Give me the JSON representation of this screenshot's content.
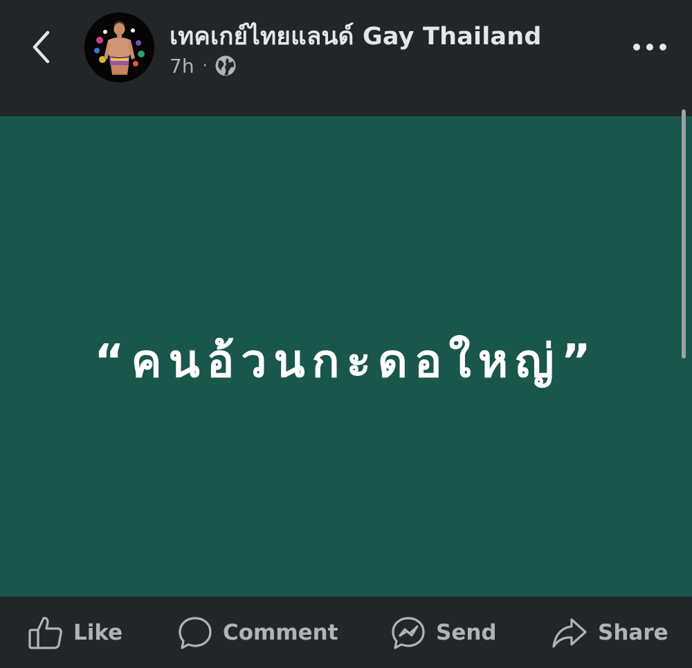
{
  "header": {
    "back_icon": "chevron-left-icon",
    "page_name": "เทคเกย์ไทยแลนด์ Gay Thailand",
    "time": "7h",
    "separator": "·",
    "privacy_icon": "globe-icon",
    "more_icon": "more-horizontal-icon"
  },
  "post": {
    "text": "“คนอ้วนกะดอใหญ่”",
    "background_color": "#19564c",
    "text_color": "#ffffff"
  },
  "actions": {
    "like_label": "Like",
    "comment_label": "Comment",
    "send_label": "Send",
    "share_label": "Share"
  },
  "colors": {
    "bar_background": "#232628",
    "secondary_text": "#b0b3b8",
    "primary_text": "#e4e6eb"
  }
}
